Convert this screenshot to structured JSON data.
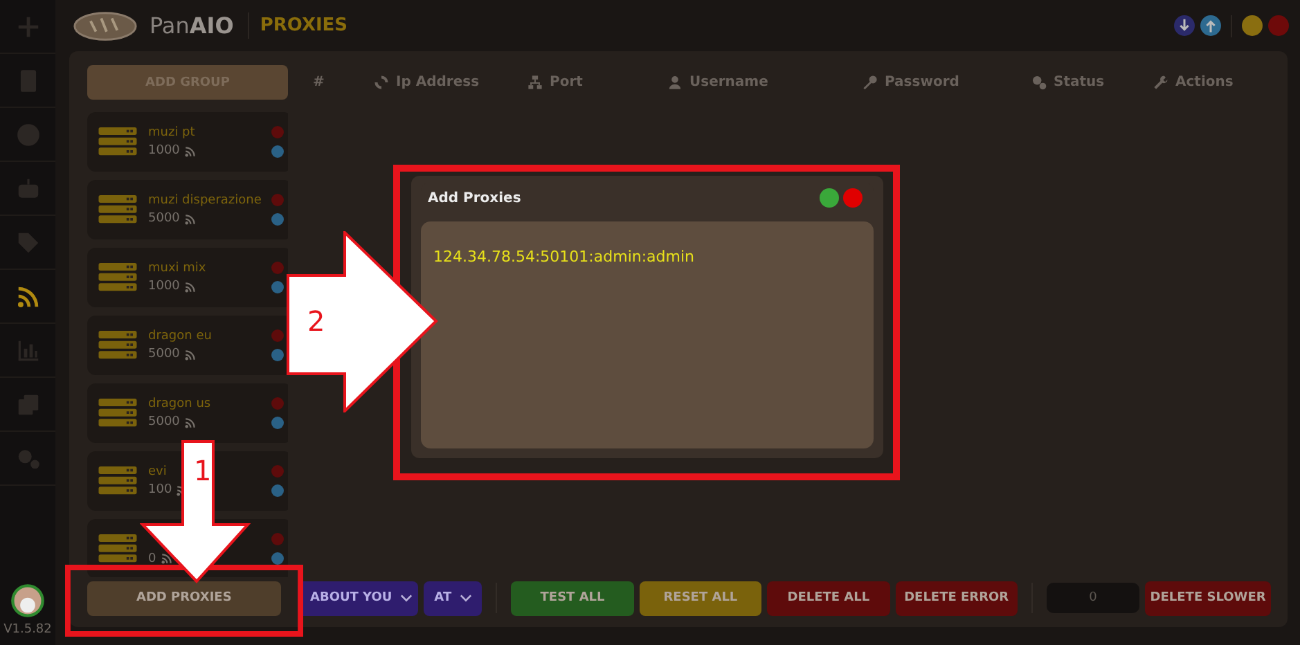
{
  "rail_items": [
    {
      "selected": false
    },
    {
      "selected": false
    },
    {
      "selected": false
    },
    {
      "selected": false
    },
    {
      "selected": false
    },
    {
      "selected": true
    },
    {
      "selected": false
    },
    {
      "selected": false
    },
    {
      "selected": false
    }
  ],
  "version": "V1.5.82",
  "header": {
    "brand": "Pan**AIO**",
    "title": "PROXIES"
  },
  "add_group_button": "ADD GROUP",
  "groups": [
    {
      "name": "muzi pt",
      "count": "1000"
    },
    {
      "name": "muzi disperazione",
      "count": "5000"
    },
    {
      "name": "muxi mix",
      "count": "1000"
    },
    {
      "name": "dragon eu",
      "count": "5000"
    },
    {
      "name": "dragon us",
      "count": "5000"
    },
    {
      "name": "evi",
      "count": "100"
    },
    {
      "count": "0"
    }
  ],
  "table": {
    "columns": [
      "#",
      "Ip Address",
      "Port",
      "Username",
      "Password",
      "Status",
      "Actions"
    ]
  },
  "toolbar": [
    {
      "kind": "button",
      "label": "ADD PROXIES",
      "color": "#4f3e2b"
    },
    {
      "kind": "dropdown",
      "label": "ABOUT YOU"
    },
    {
      "kind": "dropdown",
      "label": "AT"
    },
    {
      "kind": "button",
      "label": "TEST ALL",
      "color": "#245c1f"
    },
    {
      "kind": "button",
      "label": "RESET ALL",
      "color": "#7a620c"
    },
    {
      "kind": "button",
      "label": "DELETE ALL",
      "color": "#5e0b0b"
    },
    {
      "kind": "button",
      "label": "DELETE ERROR",
      "color": "#5e0b0b"
    },
    {
      "kind": "input",
      "value": "0"
    },
    {
      "kind": "button",
      "label": "DELETE SLOWER",
      "color": "#5e0b0b"
    }
  ],
  "modal": {
    "title": "Add Proxies",
    "value": "124.34.78.54:50101:admin:admin"
  },
  "annotations": [
    {
      "label": "1"
    },
    {
      "label": "2"
    }
  ]
}
